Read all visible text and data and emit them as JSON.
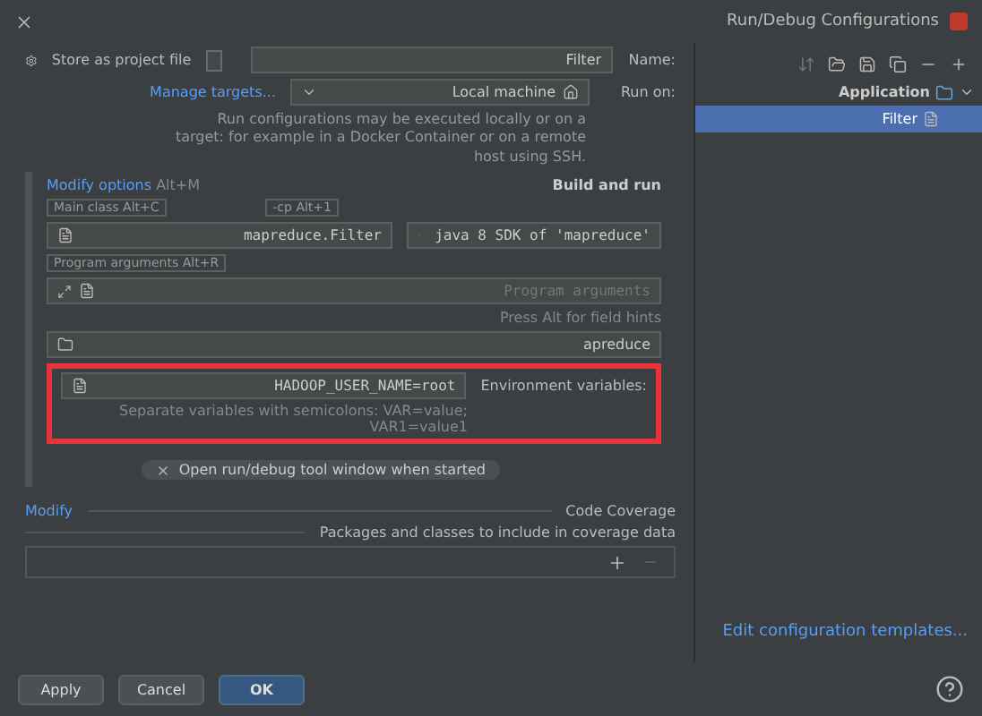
{
  "window": {
    "title": "Run/Debug Configurations"
  },
  "sidebar": {
    "tree": [
      {
        "label": "Application",
        "expanded": true,
        "selected": false,
        "children": [
          {
            "label": "Filter",
            "selected": true
          }
        ]
      }
    ],
    "templates_link": "Edit configuration templates..."
  },
  "name_row": {
    "label": "Name:",
    "value": "Filter",
    "store_label": "Store as project file",
    "store_checked": false
  },
  "run_on": {
    "label": "Run on:",
    "value": "Local machine",
    "link": "Manage targets...",
    "help": "Run configurations may be executed locally or on a target: for example in a Docker Container or on a remote host using SSH."
  },
  "build_and_run": {
    "title": "Build and run",
    "modify": "Modify options",
    "modify_shortcut": "Alt+M",
    "cp_hint": "-cp Alt+1",
    "main_hint": "Main class Alt+C",
    "sdk": "java 8 SDK of 'mapreduce'",
    "main_class": "mapreduce.Filter",
    "args_hint": "Program arguments Alt+R",
    "args_placeholder": "Program arguments",
    "field_hints": "Press Alt for field hints",
    "working_dir": "apreduce"
  },
  "environment": {
    "label": "Environment variables:",
    "value": "HADOOP_USER_NAME=root",
    "hint": "Separate variables with semicolons: VAR=value; VAR1=value1",
    "highlighted": true
  },
  "tags": [
    {
      "label": "Open run/debug tool window when started"
    }
  ],
  "coverage": {
    "title": "Code Coverage",
    "modify": "Modify",
    "packages_label": "Packages and classes to include in coverage data"
  },
  "buttons": [
    {
      "label": "Apply",
      "kind": "plain"
    },
    {
      "label": "Cancel",
      "kind": "plain"
    },
    {
      "label": "OK",
      "kind": "primary"
    }
  ]
}
